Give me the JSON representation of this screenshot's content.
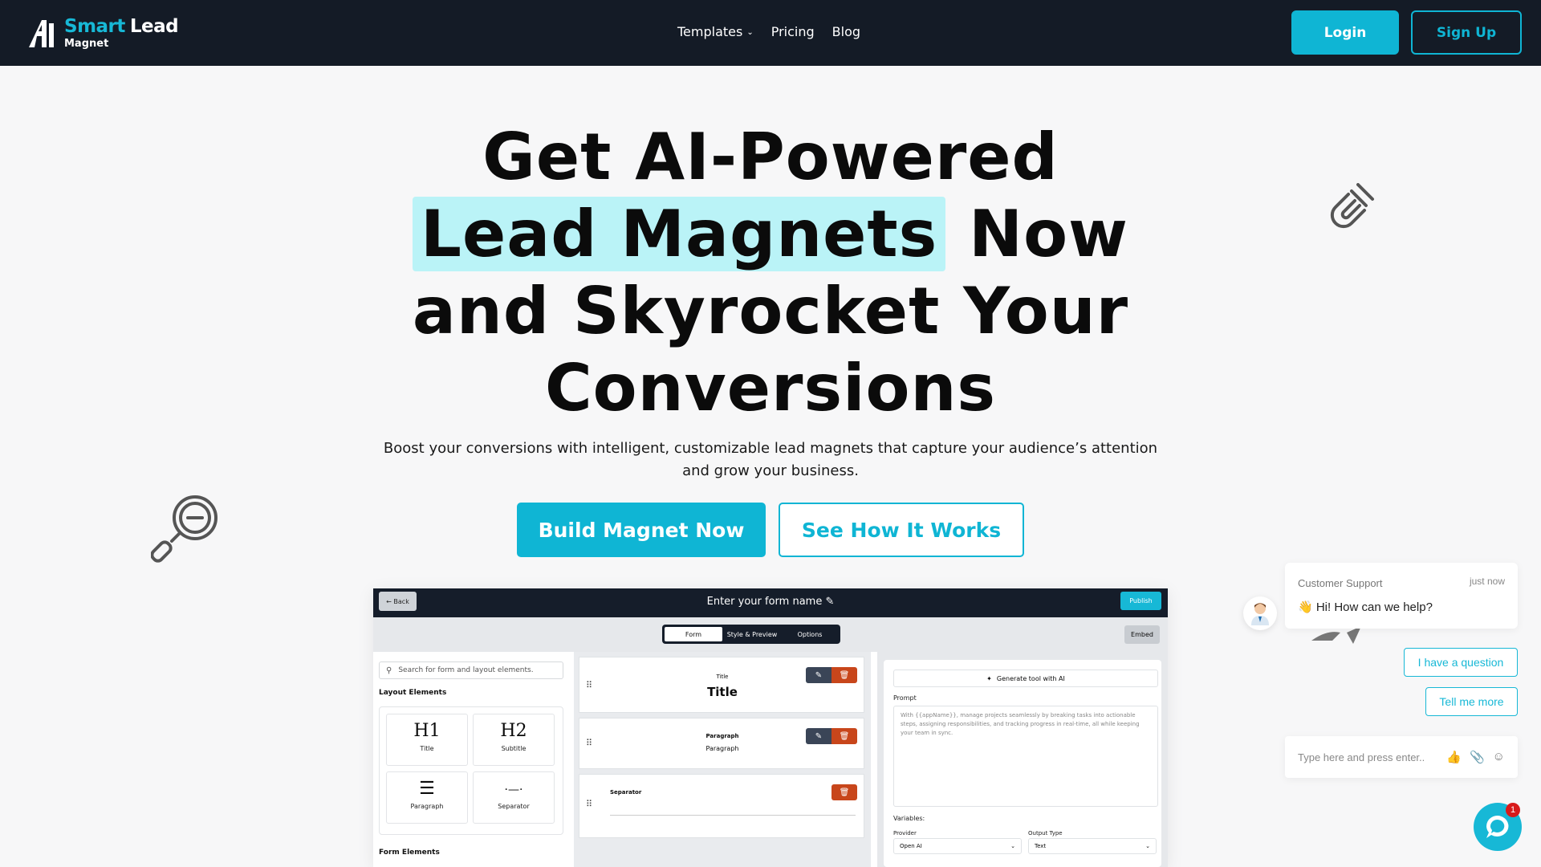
{
  "nav": {
    "logo": {
      "word1": "Smart",
      "word2": "Lead",
      "word3": "Magnet"
    },
    "menu": [
      {
        "label": "Templates",
        "has_dropdown": true
      },
      {
        "label": "Pricing"
      },
      {
        "label": "Blog"
      }
    ],
    "login_label": "Login",
    "signup_label": "Sign Up"
  },
  "hero": {
    "line1": "Get AI-Powered",
    "highlight": "Lead Magnets",
    "line2_rest": "Now",
    "line3": "and Skyrocket Your",
    "line4": "Conversions",
    "subtitle": "Boost your conversions with intelligent, customizable lead magnets that capture your audience’s attention and grow your business.",
    "cta_primary": "Build Magnet Now",
    "cta_secondary": "See How It Works"
  },
  "builder": {
    "back_label": "← Back",
    "form_name": "Enter your form name",
    "publish_label": "Publish",
    "tabs": [
      {
        "label": "Form",
        "active": true
      },
      {
        "label": "Style & Preview",
        "active": false
      },
      {
        "label": "Options",
        "active": false
      }
    ],
    "embed_label": "Embed",
    "search_placeholder": "Search for form and layout elements.",
    "layout_heading": "Layout Elements",
    "layout_items": [
      {
        "glyph": "H1",
        "label": "Title"
      },
      {
        "glyph": "H2",
        "label": "Subtitle"
      },
      {
        "glyph": "☰",
        "label": "Paragraph"
      },
      {
        "glyph": "·—·",
        "label": "Separator"
      }
    ],
    "form_heading": "Form Elements",
    "blocks": [
      {
        "type": "Title",
        "content": "Title"
      },
      {
        "type": "Paragraph",
        "content": "Paragraph"
      },
      {
        "type": "Separator",
        "content": ""
      }
    ],
    "generate_label": "Generate tool with AI",
    "prompt_label": "Prompt",
    "prompt_text": "With {{appName}}, manage projects seamlessly by breaking tasks into actionable steps, assigning responsibilities, and tracking progress in real-time, all while keeping your team in sync.",
    "variables_label": "Variables:",
    "provider_label": "Provider",
    "provider_value": "Open AI",
    "output_label": "Output Type",
    "output_value": "Text"
  },
  "chat": {
    "agent_name": "Customer Support",
    "time": "just now",
    "message": "👋 Hi! How can we help?",
    "quick_replies": [
      "I have a question",
      "Tell me more"
    ],
    "input_placeholder": "Type here and press enter..",
    "unread_count": "1"
  },
  "colors": {
    "accent": "#0fb5d4",
    "nav_bg": "#141b26",
    "highlight": "#baf3f7",
    "delete": "#c8461b"
  }
}
